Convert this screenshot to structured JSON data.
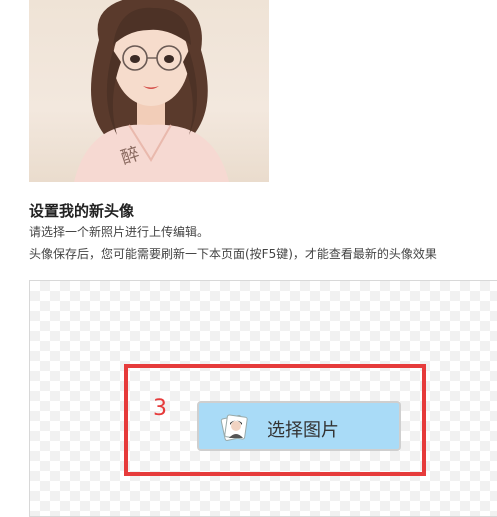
{
  "avatar": {
    "signature": "醉"
  },
  "page": {
    "title": "设置我的新头像",
    "hint_line1": "请选择一个新照片进行上传编辑。",
    "hint_line2": "头像保存后，您可能需要刷新一下本页面(按F5键)，才能查看最新的头像效果"
  },
  "upload": {
    "step_number": "3",
    "choose_label": "选择图片",
    "choose_icon": "photo-stack-icon"
  },
  "colors": {
    "highlight": "#e63b3b",
    "button_bg": "#a9dbf7"
  }
}
